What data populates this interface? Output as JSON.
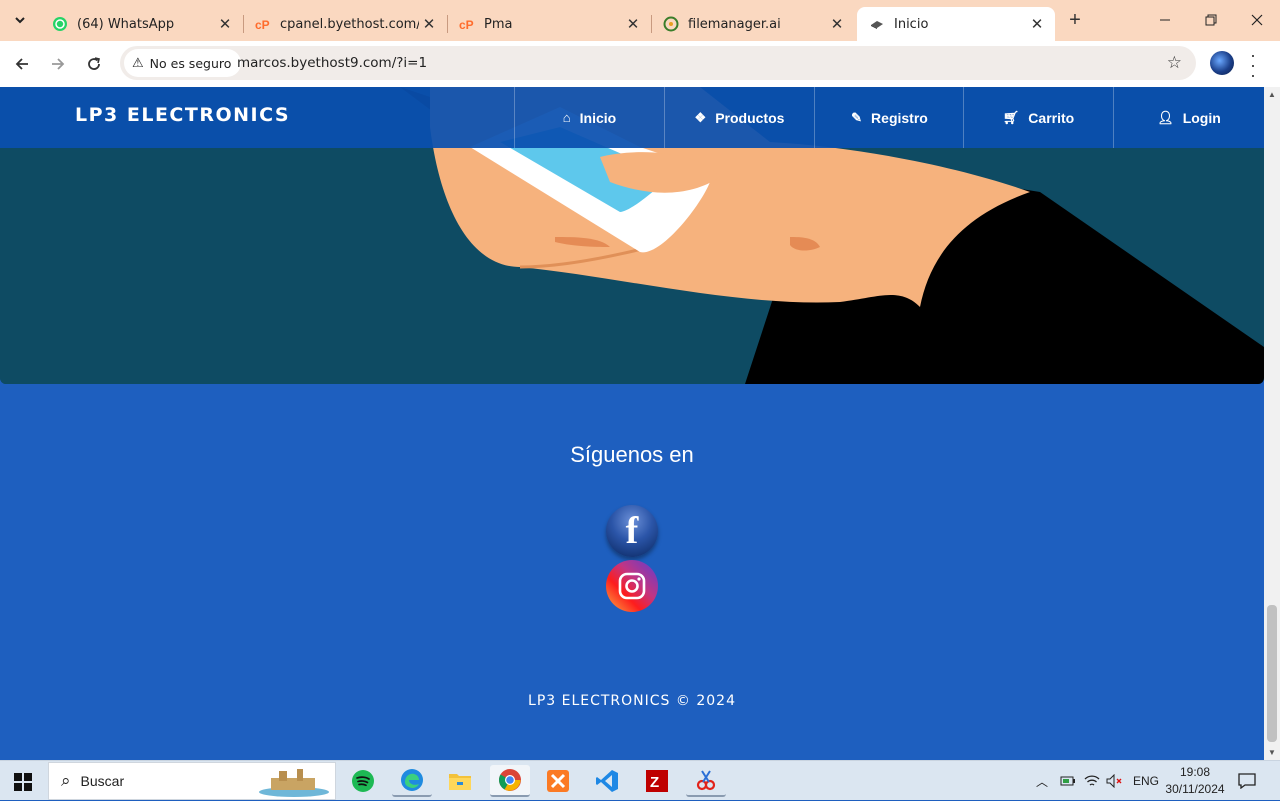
{
  "browser": {
    "tabs": [
      {
        "title": "(64) WhatsApp",
        "icon": "whatsapp-icon"
      },
      {
        "title": "cpanel.byethost.com/pan",
        "icon": "cpanel-icon"
      },
      {
        "title": "Pma",
        "icon": "cpanel-icon"
      },
      {
        "title": "filemanager.ai",
        "icon": "filemanager-icon"
      },
      {
        "title": "Inicio",
        "icon": "site-icon"
      }
    ],
    "security_label": "No es seguro",
    "url": "marcos.byethost9.com/?i=1"
  },
  "site": {
    "brand": "LP3 ELECTRONICS",
    "nav": [
      {
        "label": "Inicio",
        "icon": "home-icon"
      },
      {
        "label": "Productos",
        "icon": "dropbox-icon"
      },
      {
        "label": "Registro",
        "icon": "edit-icon"
      },
      {
        "label": "Carrito",
        "icon": "cart-icon"
      },
      {
        "label": "Login",
        "icon": "user-icon"
      }
    ],
    "follow_title": "Síguenos en",
    "copyright": "LP3 ELECTRONICS © 2024"
  },
  "taskbar": {
    "search_placeholder": "Buscar",
    "language": "ENG",
    "time": "19:08",
    "date": "30/11/2024"
  },
  "colors": {
    "tabstrip": "#fad8c0",
    "navbar": "#0a50af",
    "page_bg": "#1e5fbf",
    "hero_bg": "#0e4b63"
  }
}
